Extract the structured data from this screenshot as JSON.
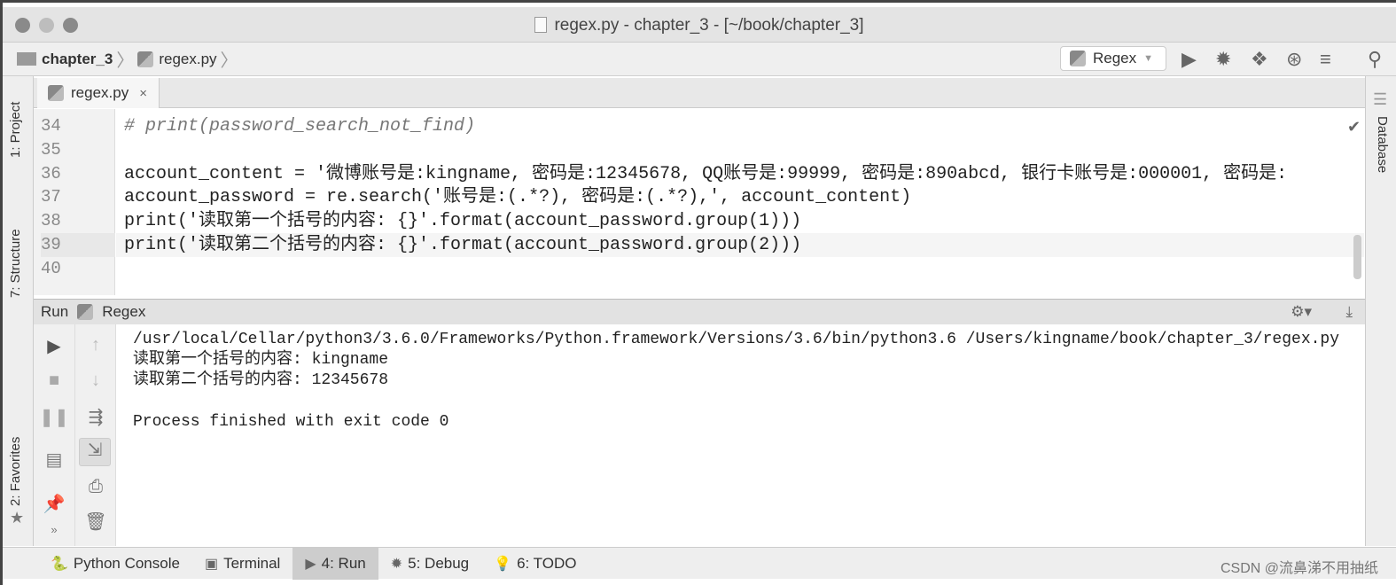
{
  "window": {
    "title": "regex.py - chapter_3 - [~/book/chapter_3]"
  },
  "breadcrumb": {
    "folder": "chapter_3",
    "file": "regex.py"
  },
  "toolbar": {
    "run_config": "Regex",
    "icons": [
      "run-icon",
      "debug-icon",
      "coverage-icon",
      "profile-icon",
      "concurrency-icon",
      "search-icon"
    ]
  },
  "editor_tab": {
    "label": "regex.py",
    "close": "×"
  },
  "left_tools": [
    "1: Project",
    "7: Structure",
    "2: Favorites"
  ],
  "right_tools": [
    "Database"
  ],
  "code": {
    "lines": [
      {
        "num": "34",
        "text": "# print(password_search_not_find)",
        "kind": "comment"
      },
      {
        "num": "35",
        "text": ""
      },
      {
        "num": "36",
        "text": "account_content = '微博账号是:kingname, 密码是:12345678, QQ账号是:99999, 密码是:890abcd, 银行卡账号是:000001, 密码是:"
      },
      {
        "num": "37",
        "text": "account_password = re.search('账号是:(.*?), 密码是:(.*?),', account_content)"
      },
      {
        "num": "38",
        "text": "print('读取第一个括号的内容: {}'.format(account_password.group(1)))"
      },
      {
        "num": "39",
        "text": "print('读取第二个括号的内容: {}'.format(account_password.group(2)))"
      },
      {
        "num": "40",
        "text": ""
      }
    ]
  },
  "run": {
    "header_label": "Run",
    "config": "Regex",
    "output": [
      "/usr/local/Cellar/python3/3.6.0/Frameworks/Python.framework/Versions/3.6/bin/python3.6 /Users/kingname/book/chapter_3/regex.py",
      "读取第一个括号的内容: kingname",
      "读取第二个括号的内容: 12345678",
      "",
      "Process finished with exit code 0"
    ]
  },
  "bottom_tabs": [
    {
      "label": "Python Console",
      "icon": "python-console-icon"
    },
    {
      "label": "Terminal",
      "icon": "terminal-icon"
    },
    {
      "label": "4: Run",
      "icon": "run-icon",
      "active": true
    },
    {
      "label": "5: Debug",
      "icon": "debug-icon"
    },
    {
      "label": "6: TODO",
      "icon": "todo-icon"
    }
  ],
  "watermark": "CSDN @流鼻涕不用抽纸"
}
